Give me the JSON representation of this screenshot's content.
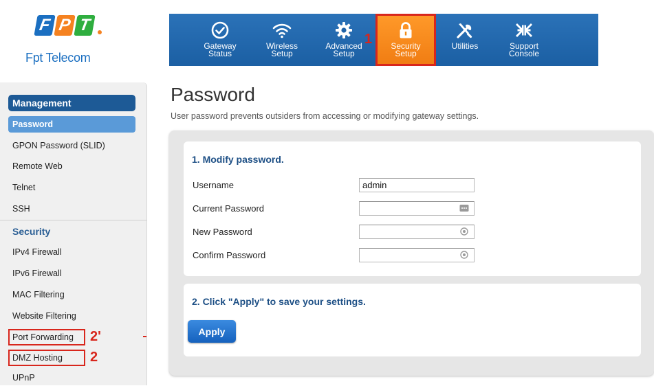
{
  "brand": {
    "letters": [
      "F",
      "P",
      "T"
    ],
    "name": "Fpt Telecom",
    "colors": {
      "blue": "#1b6fc1",
      "orange": "#f58220",
      "green": "#2fae3f"
    }
  },
  "topnav": {
    "items": [
      {
        "label": "Gateway\nStatus",
        "icon": "check-circle-icon"
      },
      {
        "label": "Wireless\nSetup",
        "icon": "wifi-icon"
      },
      {
        "label": "Advanced\nSetup",
        "icon": "gear-icon"
      },
      {
        "label": "Security\nSetup",
        "icon": "lock-icon",
        "active": true
      },
      {
        "label": "Utilities",
        "icon": "tools-icon"
      },
      {
        "label": "Support\nConsole",
        "icon": "compress-arrows-icon"
      }
    ],
    "annotation": "1"
  },
  "sidebar": {
    "management": {
      "heading": "Management",
      "items": [
        "Password",
        "GPON Password (SLID)",
        "Remote Web",
        "Telnet",
        "SSH"
      ]
    },
    "security": {
      "heading": "Security",
      "items": [
        "IPv4 Firewall",
        "IPv6 Firewall",
        "MAC Filtering",
        "Website Filtering",
        "Port Forwarding",
        "DMZ Hosting",
        "UPnP"
      ]
    },
    "annotations": {
      "port_forwarding": "2'",
      "dmz_hosting": "2"
    }
  },
  "page": {
    "title": "Password",
    "subtitle": "User password prevents outsiders from accessing or modifying gateway settings."
  },
  "section1": {
    "title": "1. Modify password.",
    "fields": {
      "username": {
        "label": "Username",
        "value": "admin"
      },
      "current": {
        "label": "Current Password",
        "value": ""
      },
      "new": {
        "label": "New Password",
        "value": ""
      },
      "confirm": {
        "label": "Confirm Password",
        "value": ""
      }
    }
  },
  "section2": {
    "title": "2. Click \"Apply\" to save your settings.",
    "apply_label": "Apply"
  }
}
